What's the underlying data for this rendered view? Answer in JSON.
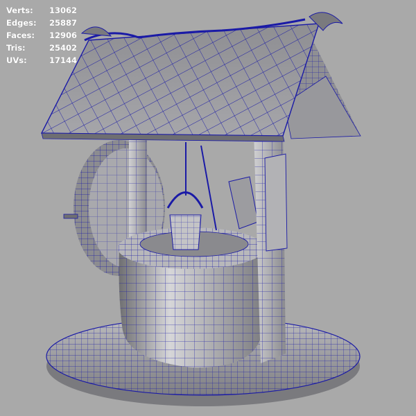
{
  "viewport": {
    "background": "#a9a9a9",
    "wire_color": "#1a1aa6",
    "shade_color": "#9a9a9c"
  },
  "hud": {
    "verts_label": "Verts:",
    "verts_value": "13062",
    "edges_label": "Edges:",
    "edges_value": "25887",
    "faces_label": "Faces:",
    "faces_value": "12906",
    "tris_label": "Tris:",
    "tris_value": "25402",
    "uvs_label": "UVs:",
    "uvs_value": "17144"
  },
  "model": {
    "subject": "wishing-well"
  }
}
